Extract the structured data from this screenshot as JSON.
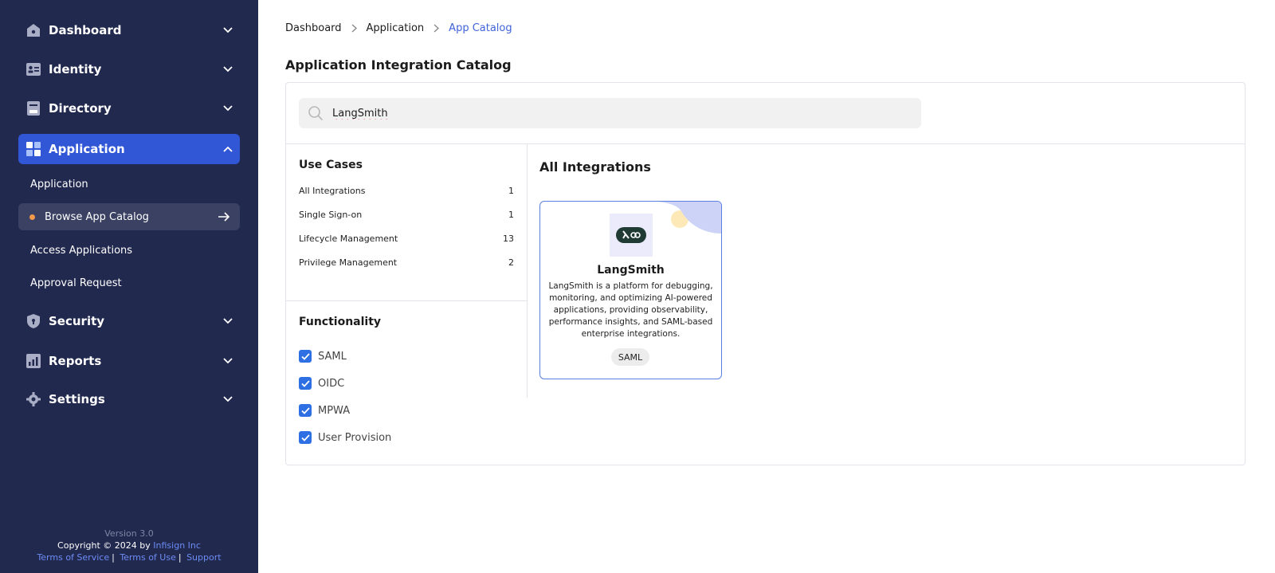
{
  "sidebar": {
    "nav": [
      {
        "label": "Dashboard",
        "icon": "house-icon"
      },
      {
        "label": "Identity",
        "icon": "id-card-icon"
      },
      {
        "label": "Directory",
        "icon": "directory-icon"
      },
      {
        "label": "Application",
        "icon": "app-grid-icon",
        "active": true
      },
      {
        "label": "Security",
        "icon": "shield-icon"
      },
      {
        "label": "Reports",
        "icon": "reports-icon"
      },
      {
        "label": "Settings",
        "icon": "gear-icon"
      }
    ],
    "sub": [
      {
        "label": "Application"
      },
      {
        "label": "Browse App Catalog",
        "active": true
      },
      {
        "label": "Access Applications"
      },
      {
        "label": "Approval Request"
      }
    ],
    "footer": {
      "version": "Version 3.0",
      "copyright": "Copyright © 2024 by",
      "company": "Infisign Inc",
      "links": [
        "Terms of Service",
        "Terms of Use",
        "Support"
      ]
    }
  },
  "breadcrumb": [
    "Dashboard",
    "Application",
    "App Catalog"
  ],
  "page_title": "Application Integration Catalog",
  "search": {
    "value": "LangSmith",
    "placeholder": ""
  },
  "use_cases": {
    "title": "Use Cases",
    "items": [
      {
        "label": "All Integrations",
        "count": "1"
      },
      {
        "label": "Single Sign-on",
        "count": "1"
      },
      {
        "label": "Lifecycle Management",
        "count": "13"
      },
      {
        "label": "Privilege Management",
        "count": "2"
      }
    ]
  },
  "functionality": {
    "title": "Functionality",
    "items": [
      {
        "label": "SAML",
        "checked": true
      },
      {
        "label": "OIDC",
        "checked": true
      },
      {
        "label": "MPWA",
        "checked": true
      },
      {
        "label": "User Provision",
        "checked": true
      }
    ]
  },
  "integrations": {
    "title": "All Integrations",
    "cards": [
      {
        "name": "LangSmith",
        "description": "LangSmith is a platform for debugging, monitoring, and optimizing AI-powered applications, providing observability, performance insights, and SAML-based enterprise integrations.",
        "tag": "SAML"
      }
    ]
  },
  "colors": {
    "sidebar_bg": "#22294f",
    "active_nav": "#3157d6",
    "accent": "#3f63d9",
    "checkbox": "#2f6fe4",
    "dot": "#f2994a"
  }
}
